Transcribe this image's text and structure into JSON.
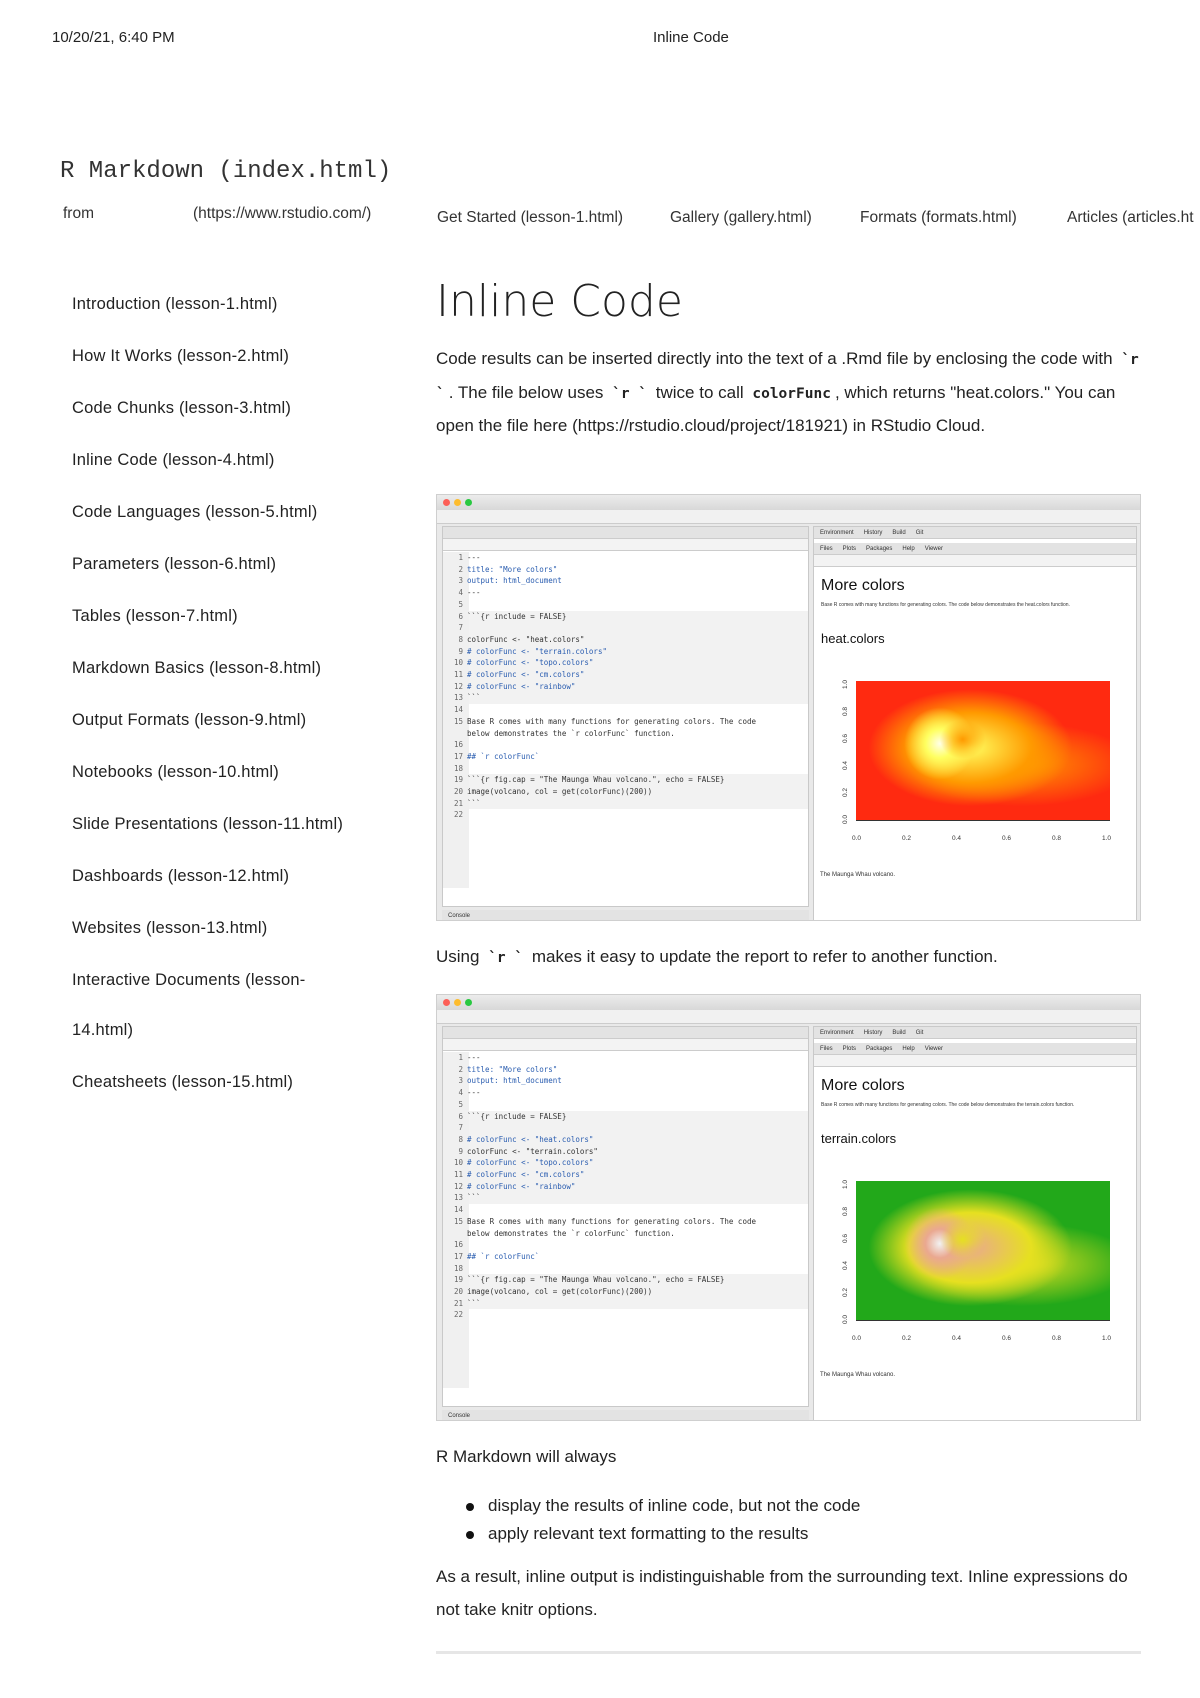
{
  "print_header": {
    "datetime": "10/20/21, 6:40 PM",
    "page_title": "Inline Code"
  },
  "navbar": {
    "brand": "R Markdown (index.html)",
    "from": "from",
    "rstudio_link": "(https://www.rstudio.com/)",
    "links": [
      "Get Started (lesson-1.html)",
      "Gallery (gallery.html)",
      "Formats (formats.html)",
      "Articles (articles.ht"
    ]
  },
  "sidebar": {
    "items": [
      "Introduction (lesson-1.html)",
      "How It Works (lesson-2.html)",
      "Code Chunks (lesson-3.html)",
      "Inline Code (lesson-4.html)",
      "Code Languages (lesson-5.html)",
      "Parameters (lesson-6.html)",
      "Tables (lesson-7.html)",
      "Markdown Basics (lesson-8.html)",
      "Output Formats (lesson-9.html)",
      "Notebooks (lesson-10.html)",
      "Slide Presentations (lesson-11.html)",
      "Dashboards (lesson-12.html)",
      "Websites (lesson-13.html)",
      "Interactive Documents (lesson-",
      "14.html)",
      "Cheatsheets (lesson-15.html)"
    ]
  },
  "main": {
    "title": "Inline Code",
    "intro": {
      "t1": "Code results can be inserted directly into the text of a .Rmd file by enclosing the code with ",
      "c1": "`r `",
      "t2": ". The file below uses ",
      "c2": "`r `",
      "t3": " twice to call ",
      "c3": "colorFunc",
      "t4": ", which returns \"heat.colors.\" You can open the file here (https://rstudio.cloud/project/181921) in RStudio Cloud."
    },
    "using": {
      "t1": "Using ",
      "c1": "`r `",
      "t2": " makes it easy to update the report to refer to another function."
    },
    "always": "R Markdown will always",
    "bullets": [
      "display the results of inline code, but not the code",
      "apply relevant text formatting to the results"
    ],
    "result": "As a result, inline output is indistinguishable from the surrounding text. Inline expressions do not take knitr options."
  },
  "shots": [
    {
      "doc_title": "More colors",
      "heading": "heat.colors",
      "desc": "Base R comes with many functions for generating colors. The code below demonstrates the heat.colors function.",
      "caption": "The Maunga Whau volcano.",
      "console": "Console",
      "viewer_tabs": [
        "Files",
        "Plots",
        "Packages",
        "Help",
        "Viewer"
      ],
      "env_tabs": [
        "Environment",
        "History",
        "Build",
        "Git"
      ],
      "code": [
        "---",
        "title: \"More colors\"",
        "output: html_document",
        "---",
        "",
        "```{r include = FALSE}",
        "",
        "colorFunc <- \"heat.colors\"",
        "# colorFunc <- \"terrain.colors\"",
        "# colorFunc <- \"topo.colors\"",
        "# colorFunc <- \"cm.colors\"",
        "# colorFunc <- \"rainbow\"",
        "```",
        "",
        "Base R comes with many functions for generating colors. The code",
        "below demonstrates the `r colorFunc` function.",
        "",
        "## `r colorFunc`",
        "",
        "```{r fig.cap = \"The Maunga Whau volcano.\", echo = FALSE}",
        "image(volcano, col = get(colorFunc)(200))",
        "```",
        ""
      ],
      "yticks": [
        "1.0",
        "0.8",
        "0.6",
        "0.4",
        "0.2",
        "0.0"
      ],
      "xticks": [
        "0.0",
        "0.2",
        "0.4",
        "0.6",
        "0.8",
        "1.0"
      ],
      "colors": {
        "bg": "#ff2a10",
        "mid": "#ff9a00",
        "hi": "#ffff60",
        "peak": "#ffffe8"
      }
    },
    {
      "doc_title": "More colors",
      "heading": "terrain.colors",
      "desc": "Base R comes with many functions for generating colors. The code below demonstrates the terrain.colors function.",
      "caption": "The Maunga Whau volcano.",
      "console": "Console",
      "viewer_tabs": [
        "Files",
        "Plots",
        "Packages",
        "Help",
        "Viewer"
      ],
      "env_tabs": [
        "Environment",
        "History",
        "Build",
        "Git"
      ],
      "code": [
        "---",
        "title: \"More colors\"",
        "output: html_document",
        "---",
        "",
        "```{r include = FALSE}",
        "",
        "# colorFunc <- \"heat.colors\"",
        "colorFunc <- \"terrain.colors\"",
        "# colorFunc <- \"topo.colors\"",
        "# colorFunc <- \"cm.colors\"",
        "# colorFunc <- \"rainbow\"",
        "```",
        "",
        "Base R comes with many functions for generating colors. The code",
        "below demonstrates the `r colorFunc` function.",
        "",
        "## `r colorFunc`",
        "",
        "```{r fig.cap = \"The Maunga Whau volcano.\", echo = FALSE}",
        "image(volcano, col = get(colorFunc)(200))",
        "```",
        ""
      ],
      "yticks": [
        "1.0",
        "0.8",
        "0.6",
        "0.4",
        "0.2",
        "0.0"
      ],
      "xticks": [
        "0.0",
        "0.2",
        "0.4",
        "0.6",
        "0.8",
        "1.0"
      ],
      "colors": {
        "bg": "#22a81a",
        "mid": "#e6e020",
        "hi": "#eaa890",
        "peak": "#f2f2f2"
      }
    }
  ]
}
